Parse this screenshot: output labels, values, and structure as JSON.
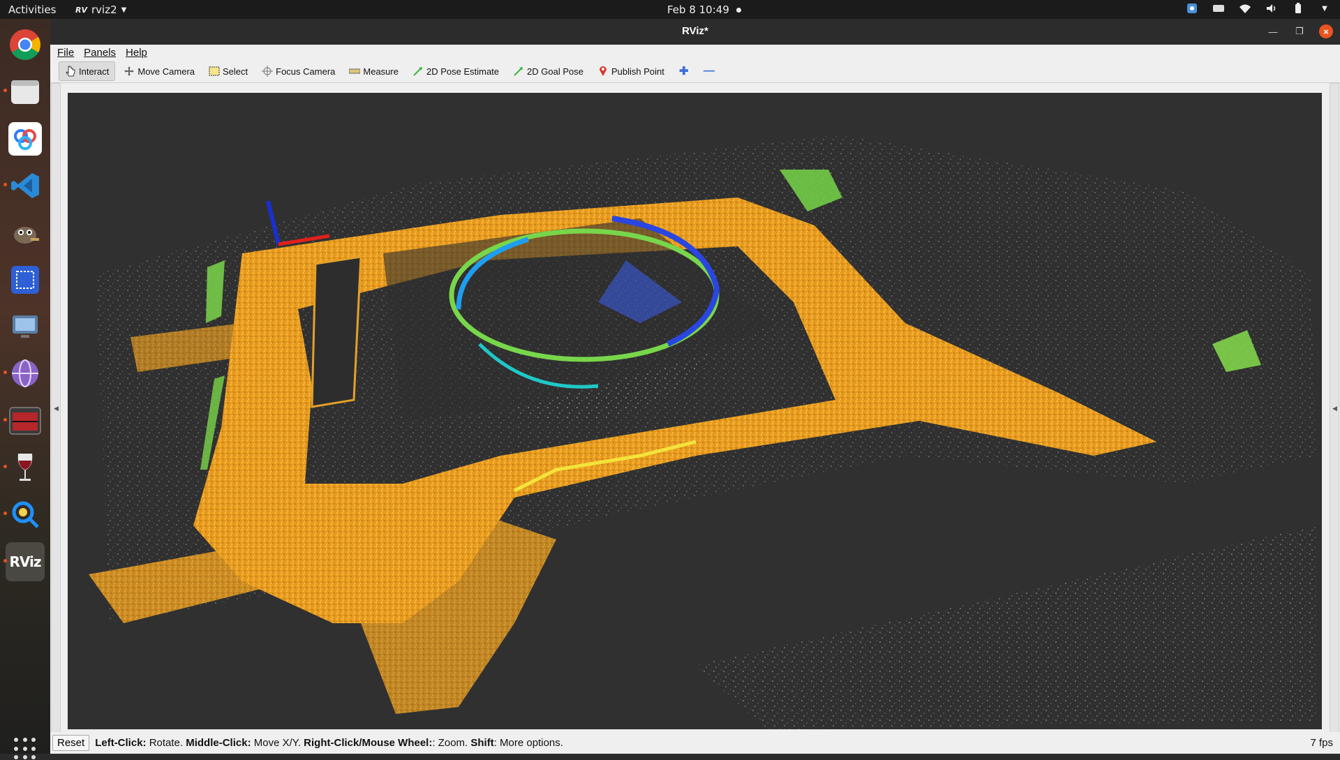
{
  "topbar": {
    "activities": "Activities",
    "app_name": "rviz2",
    "app_badge": "RV",
    "clock": "Feb 8  10:49"
  },
  "dock": {
    "items": [
      "chrome-icon",
      "files-icon",
      "baidu-netdisk-icon",
      "vscode-icon",
      "gimp-icon",
      "screenshot-icon",
      "remote-desktop-icon",
      "network-icon",
      "terminal-icon",
      "wine-icon",
      "search-icon",
      "rviz-icon"
    ],
    "rviz_label": "RViz"
  },
  "window": {
    "title": "RViz*",
    "menu": [
      "File",
      "Panels",
      "Help"
    ],
    "tools": [
      {
        "label": "Interact",
        "icon": "cursor-icon",
        "active": true
      },
      {
        "label": "Move Camera",
        "icon": "move-icon"
      },
      {
        "label": "Select",
        "icon": "select-icon"
      },
      {
        "label": "Focus Camera",
        "icon": "focus-icon"
      },
      {
        "label": "Measure",
        "icon": "ruler-icon"
      },
      {
        "label": "2D Pose Estimate",
        "icon": "pose-arrow-icon"
      },
      {
        "label": "2D Goal Pose",
        "icon": "goal-arrow-icon"
      },
      {
        "label": "Publish Point",
        "icon": "pin-icon"
      }
    ],
    "colors": {
      "active_tool_bg": "#dcdcdc",
      "viewport_bg": "#303030",
      "pointcloud_main": "#f5a623"
    }
  },
  "status": {
    "reset": "Reset",
    "left_click": "Left-Click:",
    "left_click_desc": " Rotate. ",
    "middle_click": "Middle-Click:",
    "middle_click_desc": " Move X/Y. ",
    "right_click": "Right-Click/Mouse Wheel:",
    "right_click_desc": ": Zoom. ",
    "shift": "Shift",
    "shift_desc": ": More options.",
    "fps": "7 fps"
  }
}
